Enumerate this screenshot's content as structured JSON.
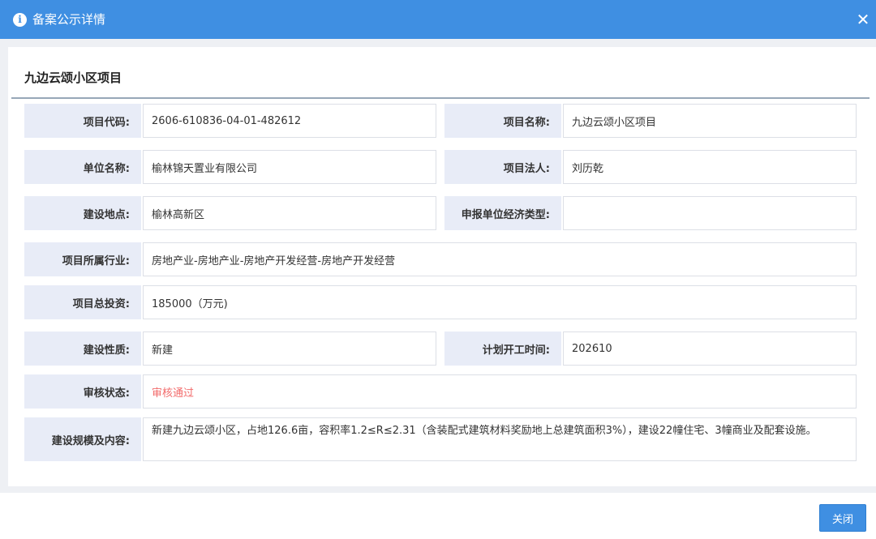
{
  "dialog": {
    "title": "备案公示详情",
    "close_icon": "close-icon",
    "info_icon": "info-icon",
    "info_glyph": "i"
  },
  "project": {
    "heading": "九边云颂小区项目"
  },
  "fields": {
    "code": {
      "label": "项目代码:",
      "value": "2606-610836-04-01-482612"
    },
    "name": {
      "label": "项目名称:",
      "value": "九边云颂小区项目"
    },
    "unit": {
      "label": "单位名称:",
      "value": "榆林锦天置业有限公司"
    },
    "legal": {
      "label": "项目法人:",
      "value": "刘历乾"
    },
    "location": {
      "label": "建设地点:",
      "value": "榆林高新区"
    },
    "econ_type": {
      "label": "申报单位经济类型:",
      "value": ""
    },
    "industry": {
      "label": "项目所属行业:",
      "value": "房地产业-房地产业-房地产开发经营-房地产开发经营"
    },
    "investment": {
      "label": "项目总投资:",
      "value": "185000（万元)"
    },
    "nature": {
      "label": "建设性质:",
      "value": "新建"
    },
    "start": {
      "label": "计划开工时间:",
      "value": "202610"
    },
    "status": {
      "label": "审核状态:",
      "value": "审核通过"
    },
    "scale": {
      "label": "建设规模及内容:",
      "value": "新建九边云颂小区，占地126.6亩，容积率1.2≤R≤2.31（含装配式建筑材料奖励地上总建筑面积3%），建设22幢住宅、3幢商业及配套设施。"
    }
  },
  "footer": {
    "close_label": "关闭"
  },
  "colors": {
    "accent": "#3f8fe2",
    "label_bg": "#e8ecf7",
    "status_pass": "#f26b6b"
  }
}
